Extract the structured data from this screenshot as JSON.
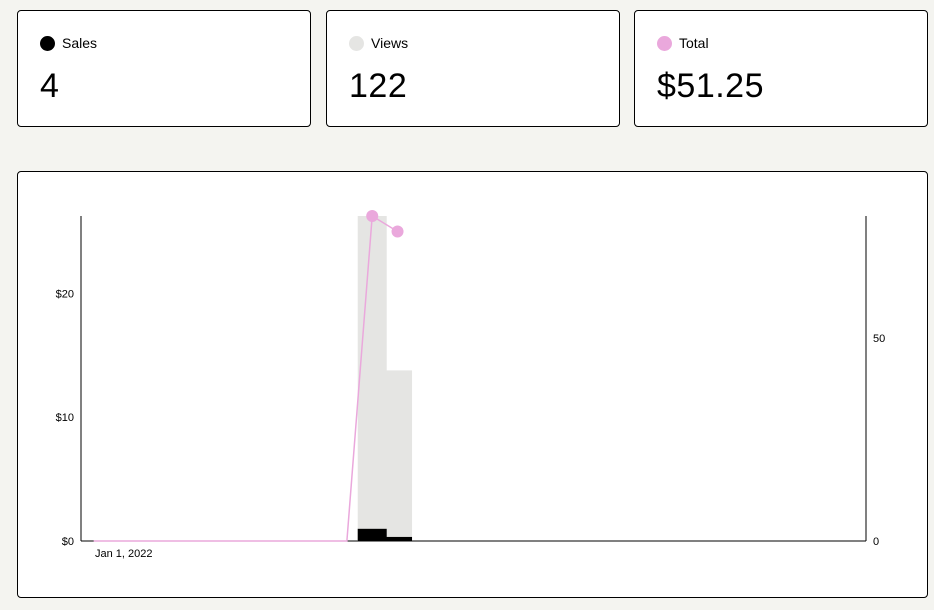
{
  "stats": {
    "sales": {
      "label": "Sales",
      "value": "4",
      "color": "#000000"
    },
    "views": {
      "label": "Views",
      "value": "122",
      "color": "#e5e5e3"
    },
    "total": {
      "label": "Total",
      "value": "$51.25",
      "color": "#eaa8dc"
    }
  },
  "chart_data": {
    "type": "bar",
    "x_label_shown": "Jan 1, 2022",
    "days": 31,
    "series": [
      {
        "name": "Views",
        "axis": "right",
        "color": "#e5e5e3",
        "points": [
          {
            "day": 12,
            "value": 80
          },
          {
            "day": 13,
            "value": 42
          }
        ]
      },
      {
        "name": "Sales",
        "axis": "right",
        "color": "#000000",
        "points": [
          {
            "day": 12,
            "value": 3
          },
          {
            "day": 13,
            "value": 1
          }
        ]
      },
      {
        "name": "Total",
        "axis": "left",
        "type": "line",
        "color": "#eaa8dc",
        "values": [
          0,
          0,
          0,
          0,
          0,
          0,
          0,
          0,
          0,
          0,
          0,
          26.25,
          25
        ]
      }
    ],
    "y_left": {
      "ticks": [
        "$0",
        "$10",
        "$20"
      ],
      "tick_values": [
        0,
        10,
        20
      ],
      "range": [
        0,
        26.25
      ]
    },
    "y_right": {
      "ticks": [
        "0",
        "50"
      ],
      "tick_values": [
        0,
        50
      ],
      "range": [
        0,
        80
      ]
    }
  }
}
